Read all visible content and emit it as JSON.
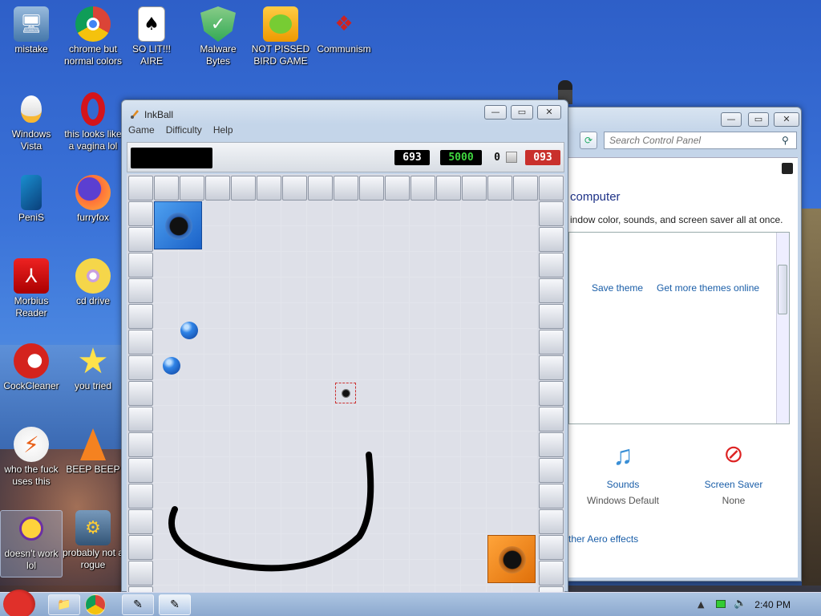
{
  "desktop": {
    "icons": [
      {
        "label": "mistake",
        "icon": "computer-lock-icon"
      },
      {
        "label": "chrome but normal colors",
        "icon": "chrome-icon"
      },
      {
        "label": "SO LIT!!! AIRE",
        "icon": "playing-cards-icon"
      },
      {
        "label": "Malware Bytes",
        "icon": "shield-check-icon"
      },
      {
        "label": "NOT PISSED BIRD GAME",
        "icon": "pig-icon"
      },
      {
        "label": "Communism",
        "icon": "emblem-icon"
      },
      {
        "label": "Windows Vista",
        "icon": "egg-icon"
      },
      {
        "label": "this looks like a vagina lol",
        "icon": "opera-icon"
      },
      {
        "label": "PeniS",
        "icon": "phone-icon"
      },
      {
        "label": "furryfox",
        "icon": "firefox-icon"
      },
      {
        "label": "Morbius Reader",
        "icon": "acrobat-icon"
      },
      {
        "label": "cd drive",
        "icon": "disc-icon"
      },
      {
        "label": "CockCleaner",
        "icon": "ccleaner-icon"
      },
      {
        "label": "you tried",
        "icon": "star-icon"
      },
      {
        "label": "who the fuck uses this",
        "icon": "lightning-icon"
      },
      {
        "label": "BEEP BEEP",
        "icon": "vlc-cone-icon"
      },
      {
        "label": "doesn't work lol",
        "icon": "yahoo-messenger-icon"
      },
      {
        "label": "probably not a rogue",
        "icon": "settings-gears-icon"
      }
    ]
  },
  "inkball": {
    "title": "InkBall",
    "menu": [
      "Game",
      "Difficulty",
      "Help"
    ],
    "time": "693",
    "score": "5000",
    "balls_remaining": "0",
    "target": "093",
    "colors": {
      "blue": "#1f6fd8",
      "orange": "#f08a1c",
      "ink": "#000000"
    }
  },
  "control_panel": {
    "search_placeholder": "Search Control Panel",
    "heading": "computer",
    "subtext": "indow color, sounds, and screen saver all at once.",
    "save_theme": "Save theme",
    "get_more": "Get more themes online",
    "sounds_label": "Sounds",
    "sounds_value": "Windows Default",
    "screensaver_label": "Screen Saver",
    "screensaver_value": "None",
    "aero_link": "ther Aero effects"
  },
  "taskbar": {
    "clock": "2:40 PM"
  }
}
